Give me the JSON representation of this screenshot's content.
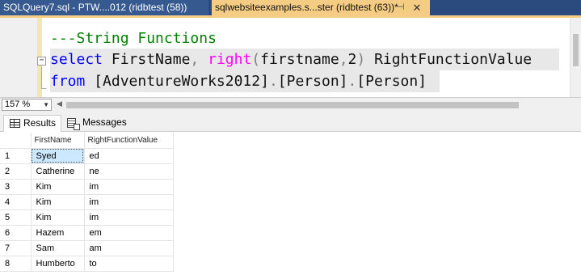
{
  "tabs": [
    {
      "label": "SQLQuery7.sql - PTW....012 (ridbtest (58))",
      "active": false
    },
    {
      "label": "sqlwebsiteexamples.s...ster (ridbtest (63))*",
      "active": true
    }
  ],
  "tab_icons": {
    "pin": "pin-icon",
    "close": "close-icon"
  },
  "editor": {
    "comment": "---String Functions",
    "line2": {
      "kw1": "select",
      "sp1": " ",
      "col1": "FirstName",
      "comma": ",",
      "sp2": " ",
      "fn": "right",
      "open": "(",
      "arg": "firstname",
      "comma2": ",",
      "num": "2",
      "close": ")",
      "sp3": " ",
      "alias": "RightFunctionValue"
    },
    "line3": {
      "kw": "from",
      "sp": " ",
      "b1": "[AdventureWorks2012]",
      "dot1": ".",
      "b2": "[Person]",
      "dot2": ".",
      "b3": "[Person]"
    }
  },
  "zoom": {
    "value": "157 %"
  },
  "results_tabs": [
    {
      "label": "Results",
      "icon": "grid-icon"
    },
    {
      "label": "Messages",
      "icon": "messages-icon"
    }
  ],
  "grid": {
    "columns": [
      "",
      "FirstName",
      "RightFunctionValue"
    ],
    "rows": [
      [
        "1",
        "Syed",
        "ed"
      ],
      [
        "2",
        "Catherine",
        "ne"
      ],
      [
        "3",
        "Kim",
        "im"
      ],
      [
        "4",
        "Kim",
        "im"
      ],
      [
        "5",
        "Kim",
        "im"
      ],
      [
        "6",
        "Hazem",
        "em"
      ],
      [
        "7",
        "Sam",
        "am"
      ],
      [
        "8",
        "Humberto",
        "to"
      ]
    ]
  },
  "colors": {
    "tabstrip": "#2b4a7e",
    "active_tab": "#f5cc84",
    "keyword": "#0000ff",
    "function": "#ff00ff",
    "comment": "#008000",
    "selection": "#cce8ff"
  }
}
